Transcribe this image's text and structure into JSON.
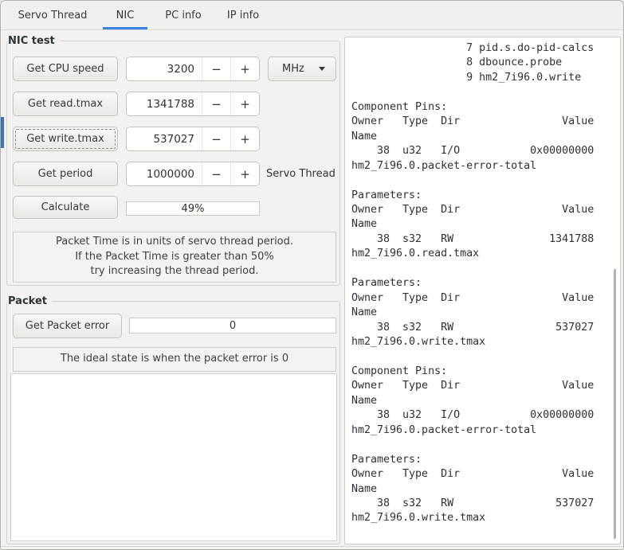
{
  "tabs": [
    {
      "label": "Servo Thread",
      "active": false
    },
    {
      "label": "NIC",
      "active": true
    },
    {
      "label": "PC info",
      "active": false
    },
    {
      "label": "IP info",
      "active": false
    }
  ],
  "controls": {
    "minus": "−",
    "plus": "+"
  },
  "icons": {
    "combo_arrow": "chevron-down"
  },
  "nic_test": {
    "title": "NIC test",
    "rows": [
      {
        "button": "Get CPU speed",
        "value": "3200",
        "unit": "MHz"
      },
      {
        "button": "Get read.tmax",
        "value": "1341788"
      },
      {
        "button": "Get write.tmax",
        "value": "537027"
      },
      {
        "button": "Get period",
        "value": "1000000",
        "side_label": "Servo Thread"
      }
    ],
    "calculate_button": "Calculate",
    "percent_value": "49%",
    "note_lines": [
      "Packet Time is in units of servo thread period.",
      "If the Packet Time is greater than 50%",
      "try increasing the thread period."
    ]
  },
  "packet": {
    "title": "Packet",
    "button": "Get Packet error",
    "error_value": "0",
    "note": "The ideal state is when the packet error is 0"
  },
  "output_panel": {
    "lines": [
      "                  7 pid.s.do-pid-calcs",
      "                  8 dbounce.probe",
      "                  9 hm2_7i96.0.write",
      "",
      "Component Pins:",
      "Owner   Type  Dir                Value",
      "Name",
      "    38  u32   I/O           0x00000000",
      "hm2_7i96.0.packet-error-total",
      "",
      "Parameters:",
      "Owner   Type  Dir                Value",
      "Name",
      "    38  s32   RW               1341788",
      "hm2_7i96.0.read.tmax",
      "",
      "Parameters:",
      "Owner   Type  Dir                Value",
      "Name",
      "    38  s32   RW                537027",
      "hm2_7i96.0.write.tmax",
      "",
      "Component Pins:",
      "Owner   Type  Dir                Value",
      "Name",
      "    38  u32   I/O           0x00000000",
      "hm2_7i96.0.packet-error-total",
      "",
      "Parameters:",
      "Owner   Type  Dir                Value",
      "Name",
      "    38  s32   RW                537027",
      "hm2_7i96.0.write.tmax"
    ]
  },
  "colors": {
    "accent_blue": "#3584e4",
    "focus_strip_blue": "#3c76b5"
  }
}
